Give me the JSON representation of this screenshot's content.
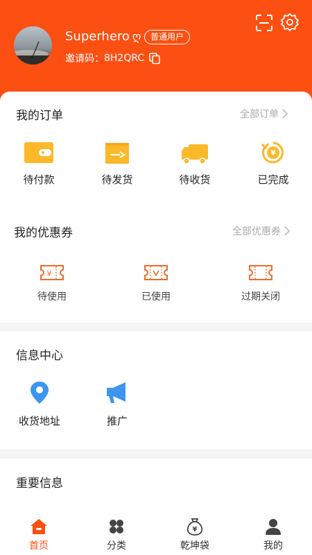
{
  "colors": {
    "brand": "#fc4f12",
    "order_icon": "#fbb829",
    "coupon_icon": "#f06a2a",
    "info_icon": "#3c96f0"
  },
  "header": {
    "username": "Superhero",
    "username_glyph": "ღ",
    "badge": "普通用户",
    "invite_label": "邀请码：",
    "invite_code": "8H2QRC",
    "icons": [
      "avatar",
      "copy-icon",
      "scan-icon",
      "gear-icon"
    ]
  },
  "orders": {
    "title": "我的订单",
    "all_link": "全部订单",
    "items": [
      {
        "label": "待付款",
        "icon": "wallet-icon"
      },
      {
        "label": "待发货",
        "icon": "box-ship-icon"
      },
      {
        "label": "待收货",
        "icon": "truck-icon"
      },
      {
        "label": "已完成",
        "icon": "yen-refresh-icon"
      }
    ]
  },
  "coupons": {
    "title": "我的优惠券",
    "all_link": "全部优惠券",
    "items": [
      {
        "label": "待使用",
        "icon": "coupon-yen-icon"
      },
      {
        "label": "已使用",
        "icon": "coupon-check-icon"
      },
      {
        "label": "过期关闭",
        "icon": "coupon-blank-icon"
      }
    ]
  },
  "info": {
    "title": "信息中心",
    "items": [
      {
        "label": "收货地址",
        "icon": "location-pin-icon"
      },
      {
        "label": "推广",
        "icon": "megaphone-icon"
      }
    ]
  },
  "important": {
    "title": "重要信息"
  },
  "tabbar": {
    "active": 0,
    "tabs": [
      {
        "label": "首页",
        "icon": "home-icon"
      },
      {
        "label": "分类",
        "icon": "category-icon"
      },
      {
        "label": "乾坤袋",
        "icon": "money-bag-icon"
      },
      {
        "label": "我的",
        "icon": "person-icon"
      }
    ]
  }
}
